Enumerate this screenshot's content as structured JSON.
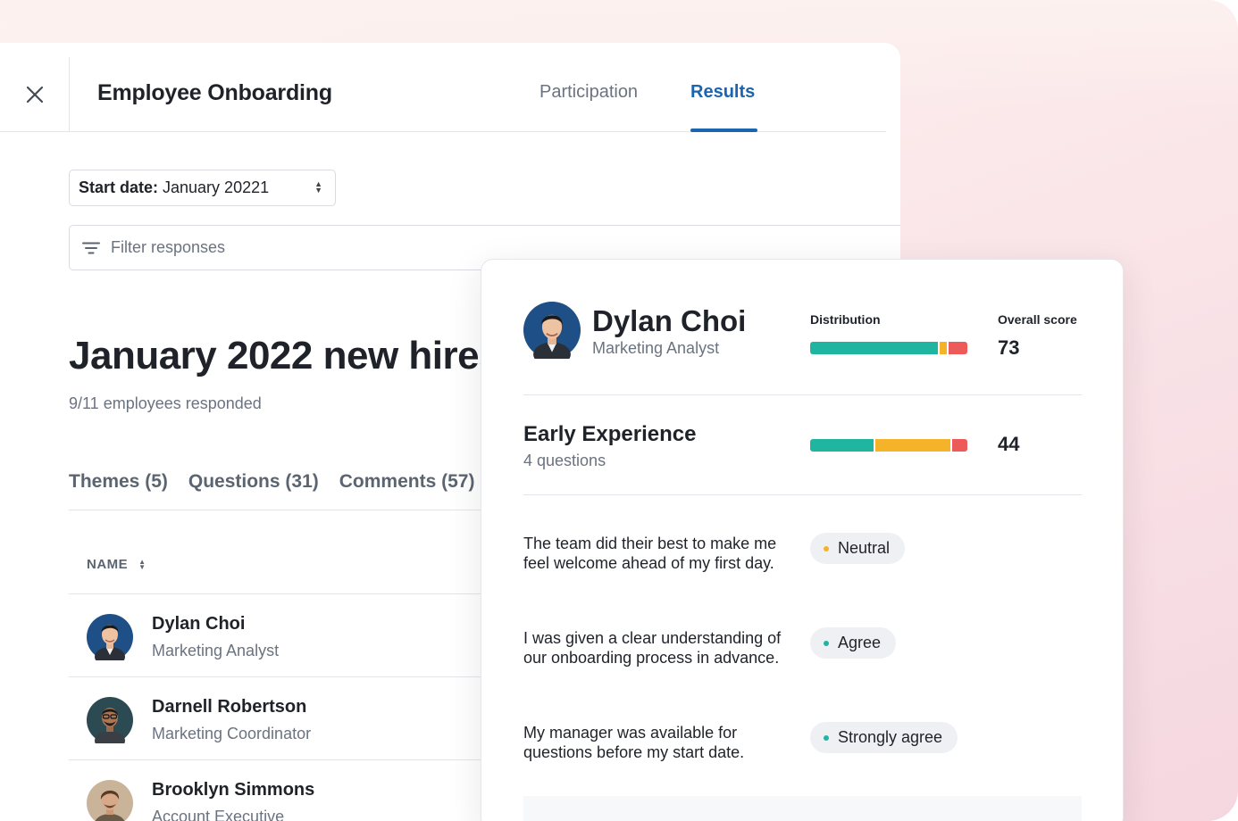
{
  "colors": {
    "accent": "#1a64b0",
    "agree": "#1fb5a0",
    "neutral": "#f5b32a",
    "disagree": "#ec5a5a"
  },
  "header": {
    "close_icon": "close-icon",
    "title": "Employee Onboarding",
    "tabs": [
      {
        "label": "Participation",
        "active": false
      },
      {
        "label": "Results",
        "active": true
      }
    ]
  },
  "filters": {
    "start_date_label": "Start date:",
    "start_date_value": "January 20221",
    "filter_icon": "filter-lines-icon",
    "filter_placeholder": "Filter responses"
  },
  "main": {
    "title": "January 2022 new hires",
    "responded": "9/11 employees responded",
    "subtabs": [
      "Themes (5)",
      "Questions (31)",
      "Comments (57)"
    ],
    "column_name": "NAME",
    "employees": [
      {
        "name": "Dylan Choi",
        "role": "Marketing Analyst"
      },
      {
        "name": "Darnell Robertson",
        "role": "Marketing Coordinator"
      },
      {
        "name": "Brooklyn Simmons",
        "role": "Account Executive"
      }
    ]
  },
  "detail": {
    "name": "Dylan Choi",
    "role": "Marketing Analyst",
    "distribution_label": "Distribution",
    "overall_score_label": "Overall score",
    "overall_score": "73",
    "overall_distribution": {
      "agree": 0.83,
      "neutral": 0.05,
      "disagree": 0.12
    },
    "section": {
      "title": "Early Experience",
      "subtitle": "4 questions",
      "score": "44",
      "distribution": {
        "agree": 0.41,
        "neutral": 0.49,
        "disagree": 0.1
      }
    },
    "questions": [
      {
        "text": "The team did their best to make me feel welcome ahead of my first day.",
        "answer": "Neutral",
        "sentiment": "neutral"
      },
      {
        "text": "I was given a clear understanding of our onboarding process in advance.",
        "answer": "Agree",
        "sentiment": "agree"
      },
      {
        "text": "My manager was available for questions before my start date.",
        "answer": "Strongly agree",
        "sentiment": "agree"
      }
    ]
  }
}
